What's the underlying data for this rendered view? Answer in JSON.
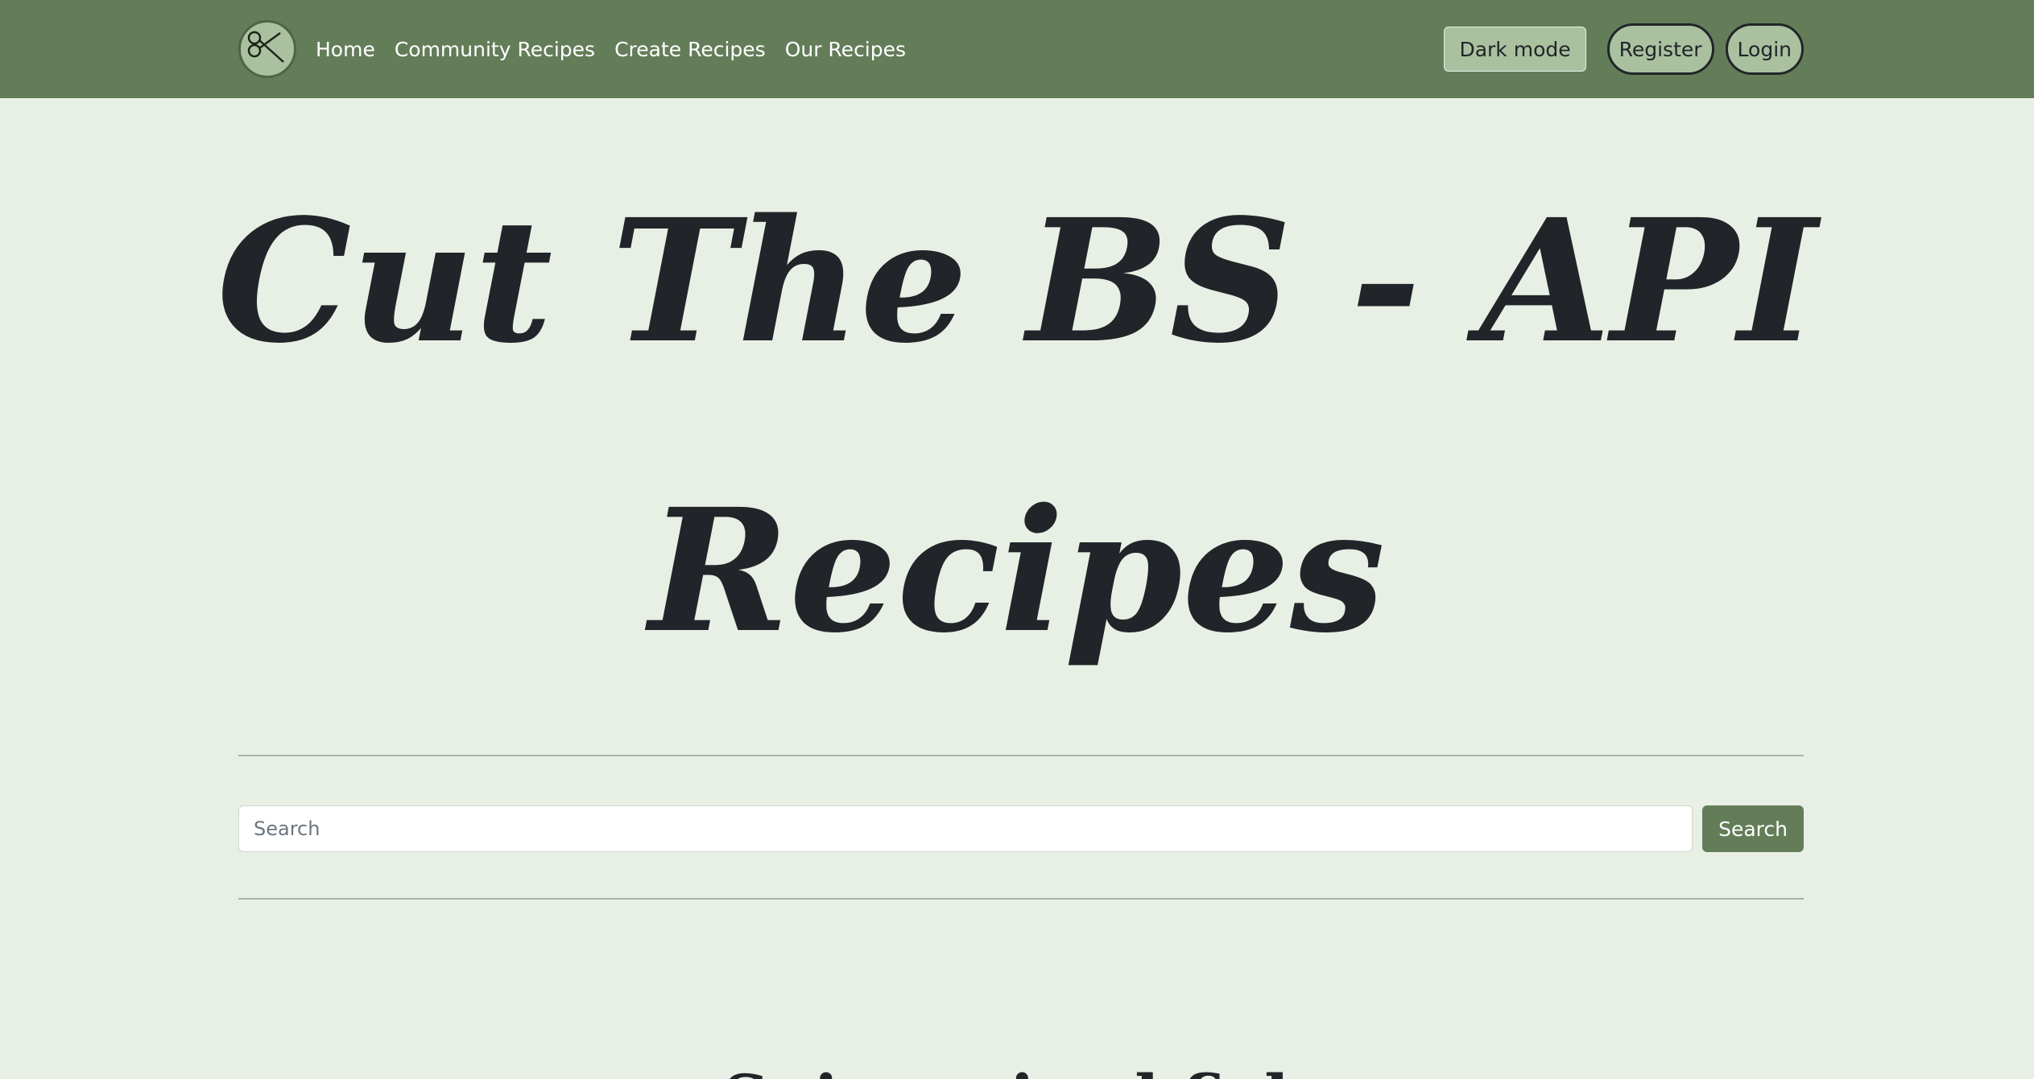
{
  "nav": {
    "logo_icon": "scissors-icon",
    "links": [
      "Home",
      "Community Recipes",
      "Create Recipes",
      "Our Recipes"
    ],
    "dark_mode_label": "Dark mode",
    "register_label": "Register",
    "login_label": "Login"
  },
  "hero": {
    "line1": "Cut The BS - API",
    "line2": "Recipes"
  },
  "search": {
    "placeholder": "Search",
    "button_label": "Search"
  },
  "section": {
    "heading": "Spicy-mixed fish"
  },
  "colors": {
    "navbar": "#637d59",
    "background": "#e8f0e5",
    "button_light": "#a9c19f",
    "accent": "#637d59"
  }
}
